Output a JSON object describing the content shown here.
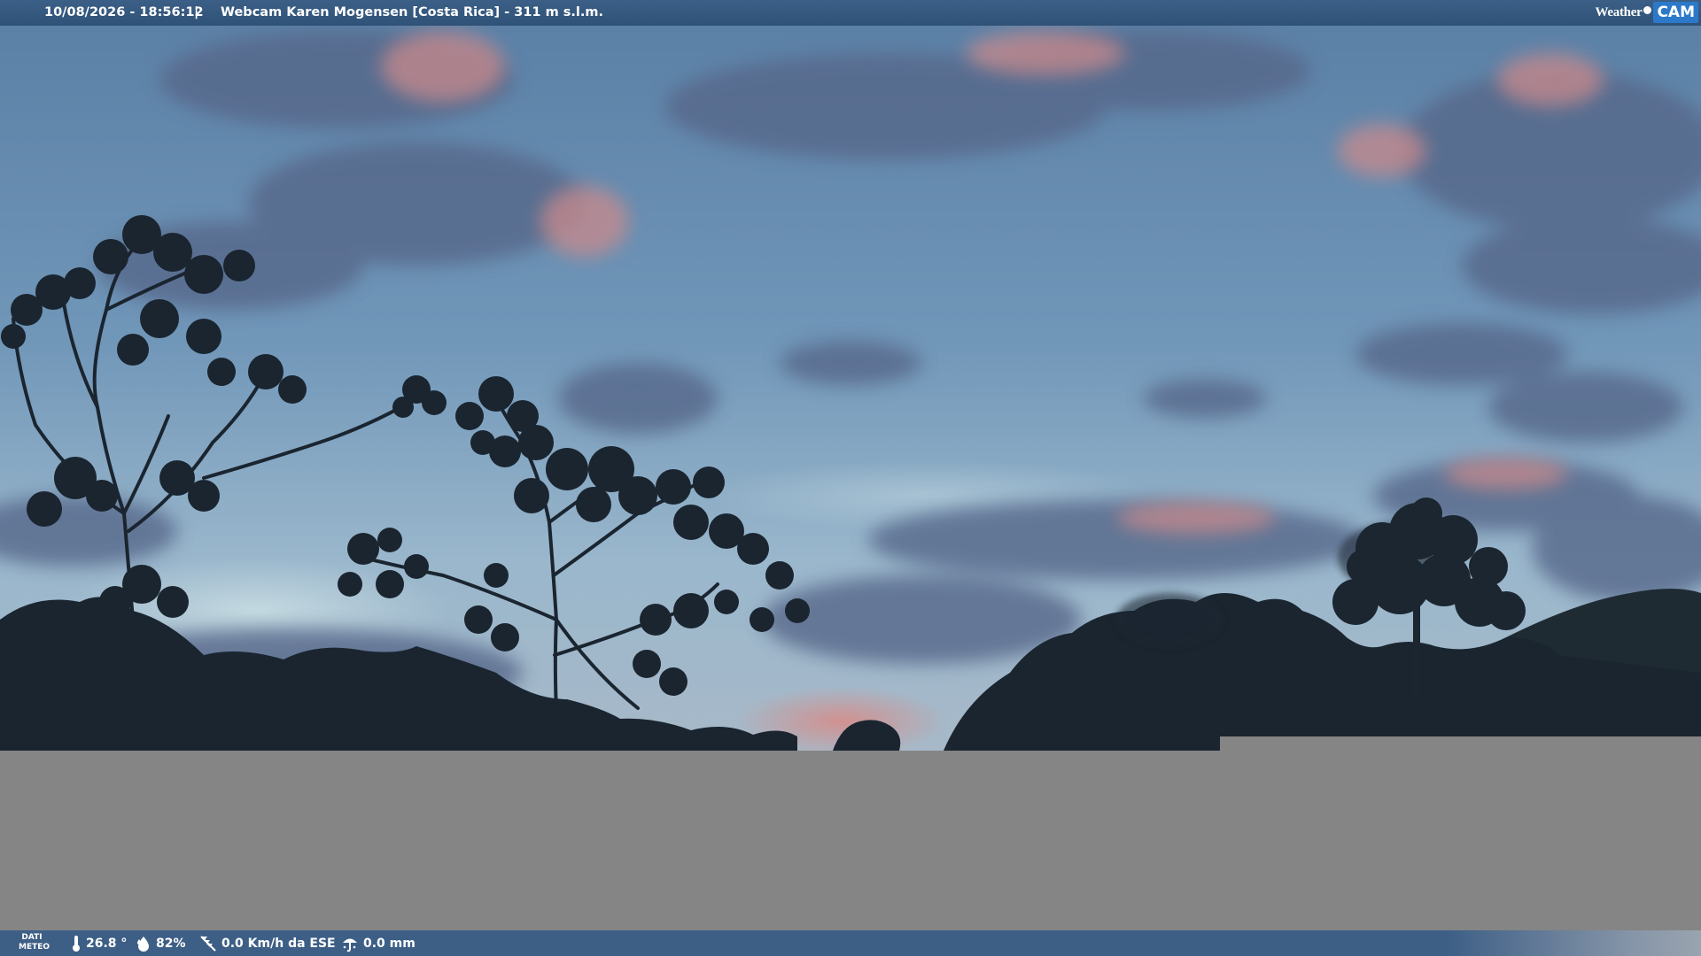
{
  "header": {
    "datetime": "10/08/2026 - 18:56:12",
    "separator": "|",
    "title": "Webcam Karen Mogensen [Costa Rica]  - 311 m s.l.m."
  },
  "brand": {
    "word": "Weather",
    "cam": "CAM"
  },
  "footer": {
    "dati_line1": "DATI",
    "dati_line2": "METEO",
    "temperature": "26.8 °",
    "humidity": "82%",
    "wind": "0.0 Km/h da ESE",
    "rain": "0.0 mm"
  },
  "icons": {
    "thermometer": "thermometer-icon",
    "humidity": "humidity-icon",
    "wind": "wind-icon",
    "rain": "rain-gauge-icon"
  },
  "colors": {
    "bar": "#3b5f86",
    "sky_top": "#5d83a8",
    "sky_horizon": "#a2bccf",
    "panel_gray": "#858585",
    "brand_blue": "#2c79c9"
  }
}
